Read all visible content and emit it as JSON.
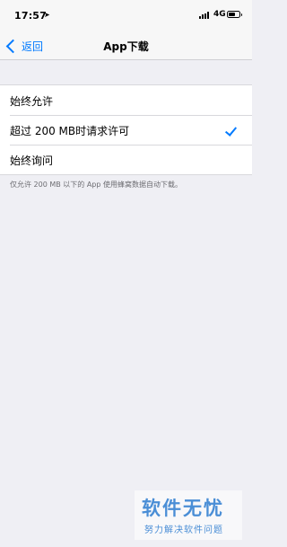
{
  "status_bar": {
    "time": "17:57",
    "network": "4G"
  },
  "nav": {
    "back_label": "返回",
    "title": "App下载"
  },
  "options": [
    {
      "label": "始终允许",
      "selected": false
    },
    {
      "label": "超过 200 MB时请求许可",
      "selected": true
    },
    {
      "label": "始终询问",
      "selected": false
    }
  ],
  "footer_note": "仅允许 200 MB 以下的 App 使用蜂窝数据自动下载。",
  "watermark": {
    "title": "软件无忧",
    "subtitle": "努力解决软件问题"
  },
  "colors": {
    "accent": "#007aff",
    "background": "#efeff4"
  }
}
